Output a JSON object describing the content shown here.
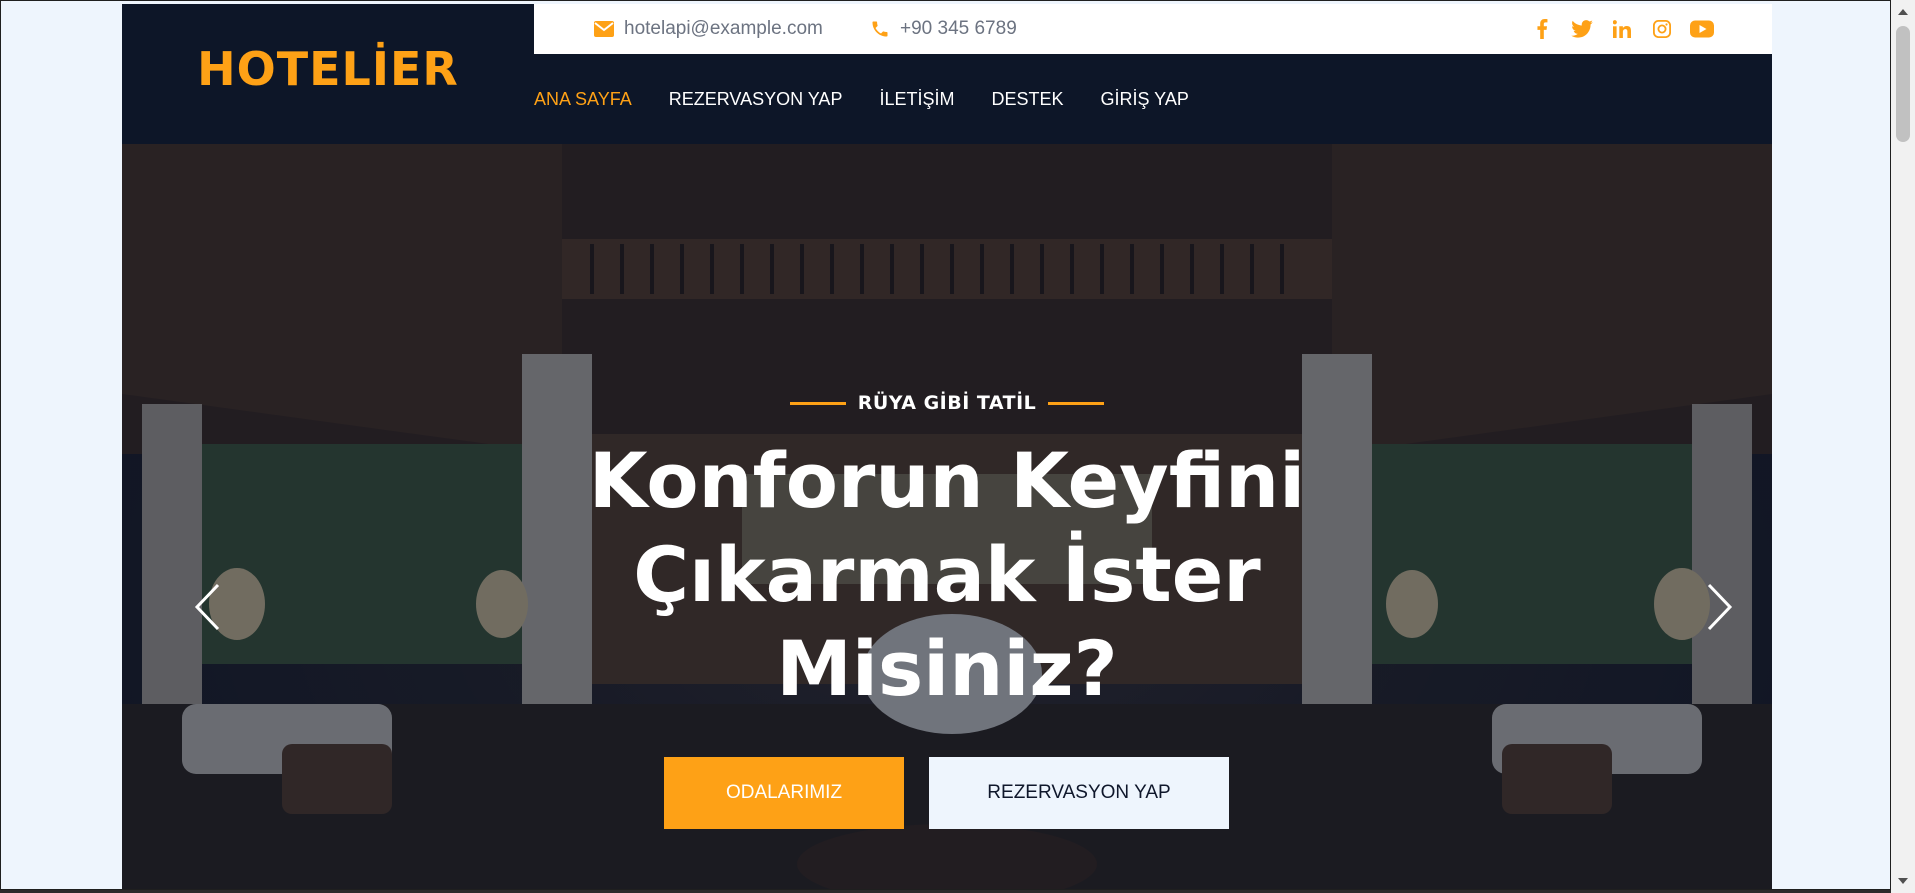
{
  "brand": {
    "name": "HOTELİER",
    "accent": "#fea116"
  },
  "topbar": {
    "email": "hotelapi@example.com",
    "phone": "+90 345 6789",
    "email_icon": "envelope-icon",
    "phone_icon": "phone-icon",
    "socials": [
      "facebook-icon",
      "twitter-icon",
      "linkedin-icon",
      "instagram-icon",
      "youtube-icon"
    ]
  },
  "nav": {
    "items": [
      {
        "label": "ANA SAYFA",
        "active": true
      },
      {
        "label": "REZERVASYON YAP",
        "active": false
      },
      {
        "label": "İLETİŞİM",
        "active": false
      },
      {
        "label": "DESTEK",
        "active": false
      },
      {
        "label": "GİRİŞ YAP",
        "active": false
      }
    ]
  },
  "hero": {
    "tagline": "RÜYA GİBİ TATİL",
    "headline_lines": [
      "Konforun Keyfini",
      "Çıkarmak İster",
      "Misiniz?"
    ],
    "primary_button": "ODALARIMIZ",
    "secondary_button": "REZERVASYON YAP",
    "prev_icon": "chevron-left-icon",
    "next_icon": "chevron-right-icon"
  },
  "colors": {
    "navy": "#0f172b",
    "light": "#eef5fd",
    "white": "#ffffff"
  }
}
